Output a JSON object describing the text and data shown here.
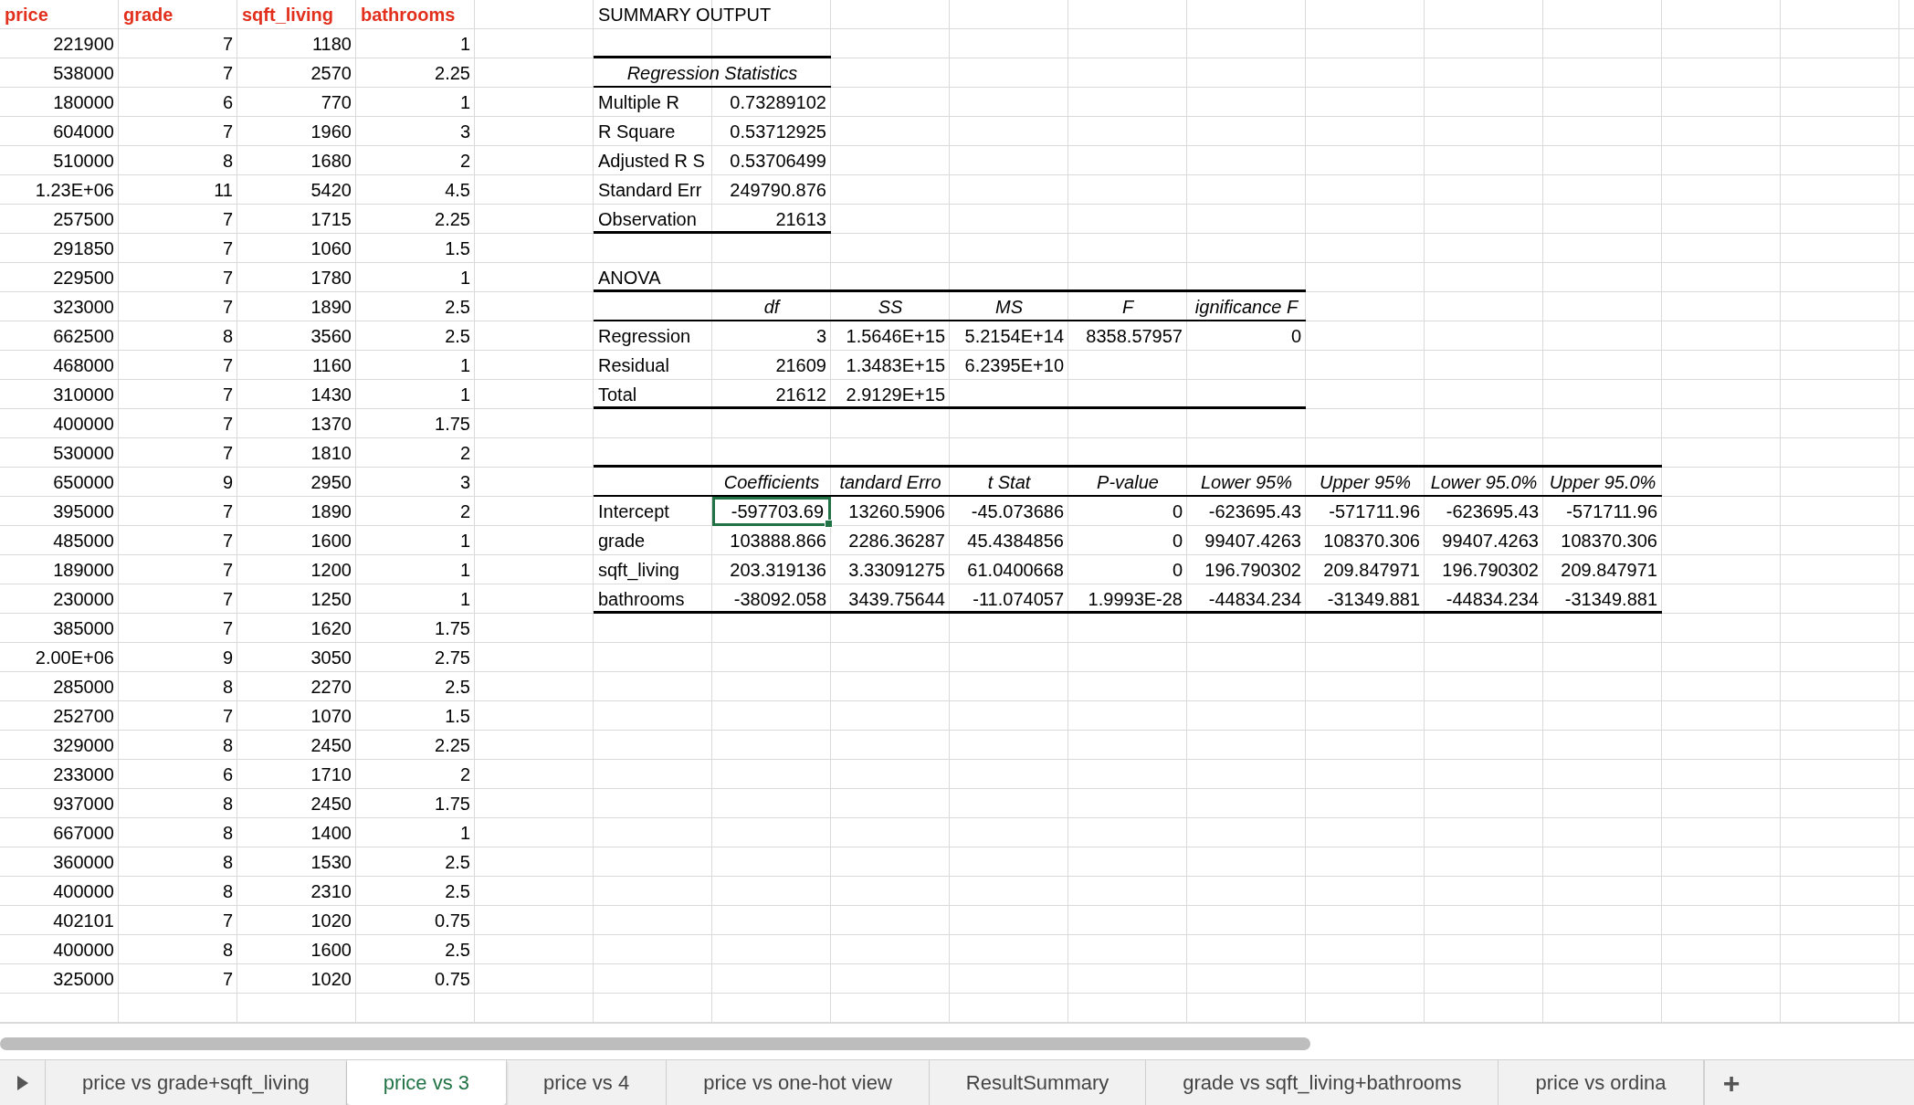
{
  "data_table": {
    "columns": [
      "price",
      "grade",
      "sqft_living",
      "bathrooms"
    ],
    "rows": [
      [
        "221900",
        "7",
        "1180",
        "1"
      ],
      [
        "538000",
        "7",
        "2570",
        "2.25"
      ],
      [
        "180000",
        "6",
        "770",
        "1"
      ],
      [
        "604000",
        "7",
        "1960",
        "3"
      ],
      [
        "510000",
        "8",
        "1680",
        "2"
      ],
      [
        "1.23E+06",
        "11",
        "5420",
        "4.5"
      ],
      [
        "257500",
        "7",
        "1715",
        "2.25"
      ],
      [
        "291850",
        "7",
        "1060",
        "1.5"
      ],
      [
        "229500",
        "7",
        "1780",
        "1"
      ],
      [
        "323000",
        "7",
        "1890",
        "2.5"
      ],
      [
        "662500",
        "8",
        "3560",
        "2.5"
      ],
      [
        "468000",
        "7",
        "1160",
        "1"
      ],
      [
        "310000",
        "7",
        "1430",
        "1"
      ],
      [
        "400000",
        "7",
        "1370",
        "1.75"
      ],
      [
        "530000",
        "7",
        "1810",
        "2"
      ],
      [
        "650000",
        "9",
        "2950",
        "3"
      ],
      [
        "395000",
        "7",
        "1890",
        "2"
      ],
      [
        "485000",
        "7",
        "1600",
        "1"
      ],
      [
        "189000",
        "7",
        "1200",
        "1"
      ],
      [
        "230000",
        "7",
        "1250",
        "1"
      ],
      [
        "385000",
        "7",
        "1620",
        "1.75"
      ],
      [
        "2.00E+06",
        "9",
        "3050",
        "2.75"
      ],
      [
        "285000",
        "8",
        "2270",
        "2.5"
      ],
      [
        "252700",
        "7",
        "1070",
        "1.5"
      ],
      [
        "329000",
        "8",
        "2450",
        "2.25"
      ],
      [
        "233000",
        "6",
        "1710",
        "2"
      ],
      [
        "937000",
        "8",
        "2450",
        "1.75"
      ],
      [
        "667000",
        "8",
        "1400",
        "1"
      ],
      [
        "360000",
        "8",
        "1530",
        "2.5"
      ],
      [
        "400000",
        "8",
        "2310",
        "2.5"
      ],
      [
        "402101",
        "7",
        "1020",
        "0.75"
      ],
      [
        "400000",
        "8",
        "1600",
        "2.5"
      ],
      [
        "325000",
        "7",
        "1020",
        "0.75"
      ]
    ]
  },
  "summary": {
    "title": "SUMMARY OUTPUT",
    "regression_statistics": {
      "heading": "Regression Statistics",
      "rows": [
        [
          "Multiple R",
          "0.73289102"
        ],
        [
          "R Square",
          "0.53712925"
        ],
        [
          "Adjusted R S",
          "0.53706499"
        ],
        [
          "Standard Err",
          "249790.876"
        ],
        [
          "Observation",
          "21613"
        ]
      ]
    },
    "anova": {
      "title": "ANOVA",
      "columns": [
        "",
        "df",
        "SS",
        "MS",
        "F",
        "ignificance F"
      ],
      "rows": [
        [
          "Regression",
          "3",
          "1.5646E+15",
          "5.2154E+14",
          "8358.57957",
          "0"
        ],
        [
          "Residual",
          "21609",
          "1.3483E+15",
          "6.2395E+10"
        ],
        [
          "Total",
          "21612",
          "2.9129E+15"
        ]
      ]
    },
    "coefficients": {
      "columns": [
        "",
        "Coefficients",
        "tandard Erro",
        "t Stat",
        "P-value",
        "Lower 95%",
        "Upper 95%",
        "Lower 95.0%",
        "Upper 95.0%"
      ],
      "rows": [
        {
          "label": "Intercept",
          "values": [
            {
              "text": "-597703.69",
              "selected": true
            },
            {
              "text": "13260.5906",
              "selected": false
            },
            {
              "text": "-45.073686",
              "selected": false
            },
            {
              "text": "0",
              "selected": false
            },
            {
              "text": "-623695.43",
              "selected": false
            },
            {
              "text": "-571711.96",
              "selected": false
            },
            {
              "text": "-623695.43",
              "selected": false
            },
            {
              "text": "-571711.96",
              "selected": false
            }
          ]
        },
        {
          "label": "grade",
          "values": [
            {
              "text": "103888.866",
              "selected": false
            },
            {
              "text": "2286.36287",
              "selected": false
            },
            {
              "text": "45.4384856",
              "selected": false
            },
            {
              "text": "0",
              "selected": false
            },
            {
              "text": "99407.4263",
              "selected": false
            },
            {
              "text": "108370.306",
              "selected": false
            },
            {
              "text": "99407.4263",
              "selected": false
            },
            {
              "text": "108370.306",
              "selected": false
            }
          ]
        },
        {
          "label": "sqft_living",
          "values": [
            {
              "text": "203.319136",
              "selected": false
            },
            {
              "text": "3.33091275",
              "selected": false
            },
            {
              "text": "61.0400668",
              "selected": false
            },
            {
              "text": "0",
              "selected": false
            },
            {
              "text": "196.790302",
              "selected": false
            },
            {
              "text": "209.847971",
              "selected": false
            },
            {
              "text": "196.790302",
              "selected": false
            },
            {
              "text": "209.847971",
              "selected": false
            }
          ]
        },
        {
          "label": "bathrooms",
          "values": [
            {
              "text": "-38092.058",
              "selected": false
            },
            {
              "text": "3439.75644",
              "selected": false
            },
            {
              "text": "-11.074057",
              "selected": false
            },
            {
              "text": "1.9993E-28",
              "selected": false
            },
            {
              "text": "-44834.234",
              "selected": false
            },
            {
              "text": "-31349.881",
              "selected": false
            },
            {
              "text": "-44834.234",
              "selected": false
            },
            {
              "text": "-31349.881",
              "selected": false
            }
          ]
        }
      ]
    }
  },
  "sheet_tabs": [
    {
      "label": "price vs grade+sqft_living",
      "selected": false
    },
    {
      "label": "price vs 3",
      "selected": true
    },
    {
      "label": "price vs 4",
      "selected": false
    },
    {
      "label": "price vs one-hot view",
      "selected": false
    },
    {
      "label": "ResultSummary",
      "selected": false
    },
    {
      "label": "grade vs sqft_living+bathrooms",
      "selected": false
    },
    {
      "label": "price vs ordina",
      "selected": false
    }
  ],
  "add_sheet": "+"
}
